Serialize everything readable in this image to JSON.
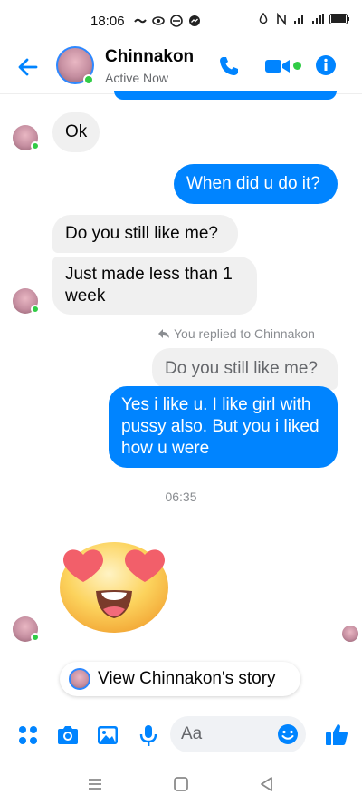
{
  "status_bar": {
    "time": "18:06",
    "icons_left": [
      "tilde-icon",
      "eye-icon",
      "signal-circle-icon",
      "messenger-icon"
    ],
    "icons_right": [
      "drop-icon",
      "nfc-icon",
      "signal-icon",
      "4g-signal-icon",
      "battery-icon"
    ]
  },
  "header": {
    "name": "Chinnakon",
    "status": "Active Now",
    "accent": "#0084ff",
    "online_color": "#31cc46"
  },
  "messages": [
    {
      "id": "m1",
      "side": "in",
      "text": "Ok"
    },
    {
      "id": "m2",
      "side": "out",
      "text": "When did u do it?"
    },
    {
      "id": "m3",
      "side": "in",
      "text": "Do you still like me?"
    },
    {
      "id": "m4",
      "side": "in",
      "text": "Just made less than 1 week"
    },
    {
      "id": "m5",
      "side": "out",
      "reply_note": "You replied to Chinnakon",
      "quoted": "Do you still like me?",
      "text": "Yes i like u.  I like girl with pussy also.  But you i liked how u were"
    }
  ],
  "time_separator": "06:35",
  "sticker": "heart-eyes-emoji",
  "story_button": {
    "label": "View Chinnakon's story"
  },
  "composer": {
    "placeholder": "Aa",
    "icons": [
      "menu-dots-icon",
      "camera-icon",
      "gallery-icon",
      "microphone-icon",
      "emoji-icon",
      "thumbs-up-icon"
    ]
  },
  "nav": {
    "icons": [
      "menu-icon",
      "home-icon",
      "back-icon"
    ]
  }
}
